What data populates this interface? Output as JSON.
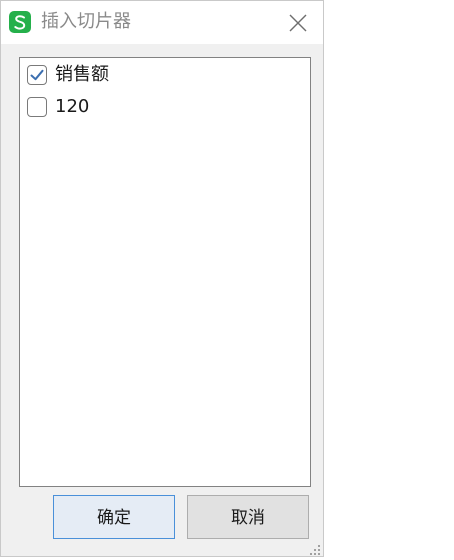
{
  "window": {
    "title": "插入切片器",
    "app_icon": "wps-spreadsheet-icon",
    "close_icon": "close-icon"
  },
  "list": {
    "items": [
      {
        "label": "销售额",
        "checked": true
      },
      {
        "label": "120",
        "checked": false
      }
    ]
  },
  "buttons": {
    "ok_label": "确定",
    "cancel_label": "取消"
  },
  "colors": {
    "app_icon_bg": "#25b04b",
    "check_mark": "#3c6fb0",
    "ok_border": "#4a90d9"
  }
}
